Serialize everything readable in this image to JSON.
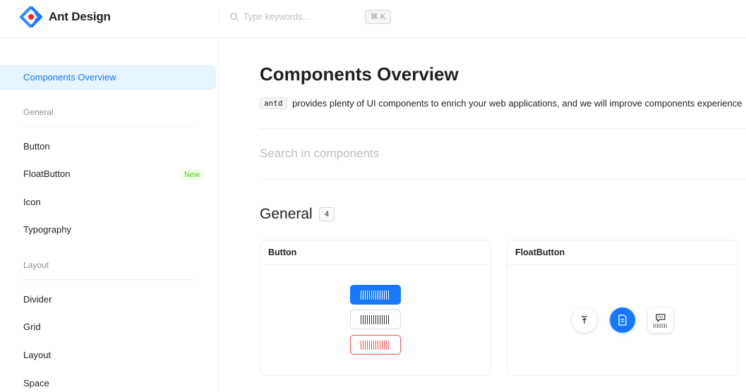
{
  "header": {
    "brand": "Ant Design",
    "search_placeholder": "Type keywords...",
    "shortcut": "⌘ K",
    "accent_color": "#1677ff"
  },
  "sidebar": {
    "overview": "Components Overview",
    "groups": [
      {
        "label": "General",
        "items": [
          "Button",
          "FloatButton",
          "Icon",
          "Typography"
        ]
      },
      {
        "label": "Layout",
        "items": [
          "Divider",
          "Grid",
          "Layout",
          "Space"
        ]
      }
    ],
    "new_tag": "New"
  },
  "main": {
    "title": "Components Overview",
    "intro_code": "antd",
    "intro_text": "provides plenty of UI components to enrich your web applications, and we will improve components experience",
    "search_placeholder": "Search in components",
    "section": {
      "title": "General",
      "count": "4"
    },
    "cards": [
      {
        "title": "Button"
      },
      {
        "title": "FloatButton"
      }
    ]
  }
}
